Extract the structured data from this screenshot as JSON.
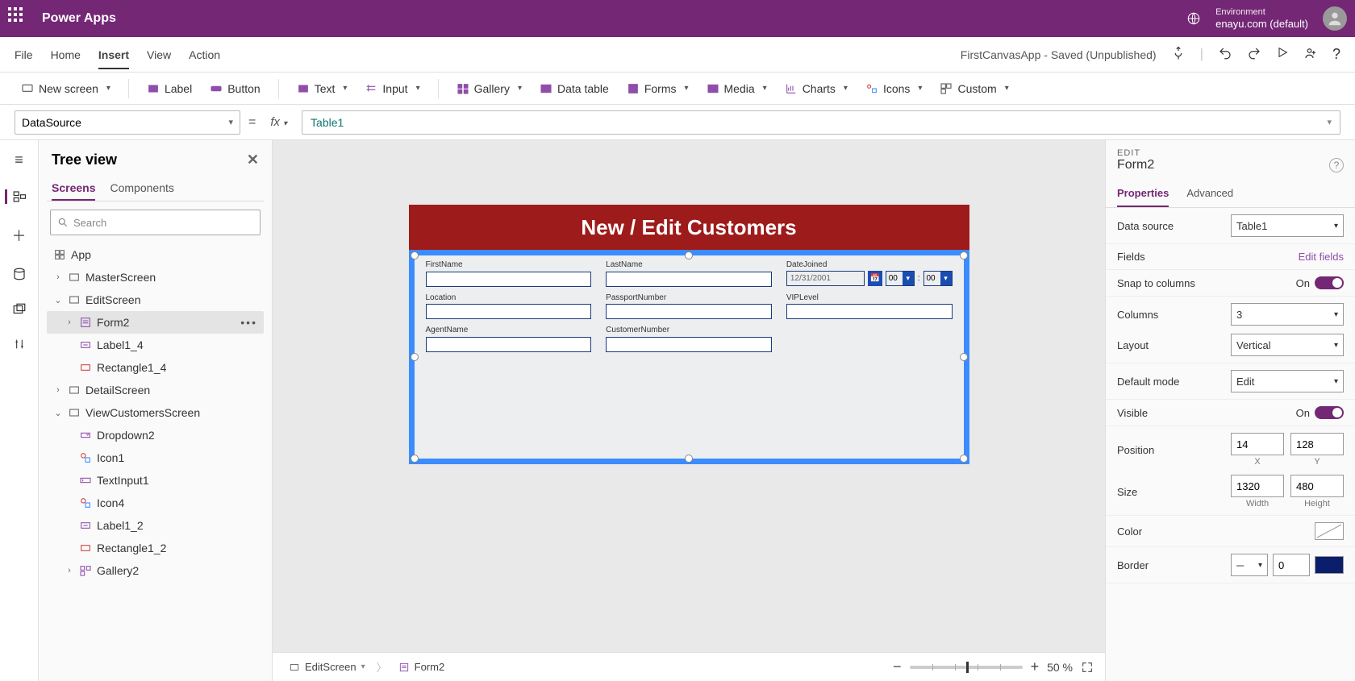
{
  "header": {
    "app_title": "Power Apps",
    "env_label": "Environment",
    "env_name": "enayu.com (default)"
  },
  "menu": {
    "items": [
      "File",
      "Home",
      "Insert",
      "View",
      "Action"
    ],
    "active": "Insert",
    "saved_status": "FirstCanvasApp - Saved (Unpublished)"
  },
  "ribbon": {
    "new_screen": "New screen",
    "label": "Label",
    "button": "Button",
    "text": "Text",
    "input": "Input",
    "gallery": "Gallery",
    "data_table": "Data table",
    "forms": "Forms",
    "media": "Media",
    "charts": "Charts",
    "icons": "Icons",
    "custom": "Custom"
  },
  "formula": {
    "property": "DataSource",
    "value": "Table1"
  },
  "tree": {
    "title": "Tree view",
    "tabs": [
      "Screens",
      "Components"
    ],
    "search_placeholder": "Search",
    "items": {
      "app": "App",
      "master": "MasterScreen",
      "edit": "EditScreen",
      "form2": "Form2",
      "label14": "Label1_4",
      "rect14": "Rectangle1_4",
      "detail": "DetailScreen",
      "viewcust": "ViewCustomersScreen",
      "dropdown2": "Dropdown2",
      "icon1": "Icon1",
      "textinput1": "TextInput1",
      "icon4": "Icon4",
      "label12": "Label1_2",
      "rect12": "Rectangle1_2",
      "gallery2": "Gallery2"
    }
  },
  "canvas": {
    "screen_title": "New / Edit Customers",
    "fields": {
      "firstname": "FirstName",
      "lastname": "LastName",
      "datejoined": "DateJoined",
      "date_value": "12/31/2001",
      "hour": "00",
      "minute": "00",
      "location": "Location",
      "passport": "PassportNumber",
      "viplevel": "VIPLevel",
      "agentname": "AgentName",
      "custnumber": "CustomerNumber"
    },
    "breadcrumb": {
      "screen": "EditScreen",
      "control": "Form2"
    },
    "zoom": "50  %"
  },
  "props": {
    "type": "EDIT",
    "name": "Form2",
    "tabs": [
      "Properties",
      "Advanced"
    ],
    "data_source_label": "Data source",
    "data_source_value": "Table1",
    "fields_label": "Fields",
    "edit_fields": "Edit fields",
    "snap_label": "Snap to columns",
    "snap_state": "On",
    "columns_label": "Columns",
    "columns_value": "3",
    "layout_label": "Layout",
    "layout_value": "Vertical",
    "default_mode_label": "Default mode",
    "default_mode_value": "Edit",
    "visible_label": "Visible",
    "visible_state": "On",
    "position_label": "Position",
    "pos_x": "14",
    "pos_y": "128",
    "pos_x_lbl": "X",
    "pos_y_lbl": "Y",
    "size_label": "Size",
    "width": "1320",
    "height": "480",
    "width_lbl": "Width",
    "height_lbl": "Height",
    "color_label": "Color",
    "border_label": "Border",
    "border_value": "0",
    "border_style": "─"
  }
}
